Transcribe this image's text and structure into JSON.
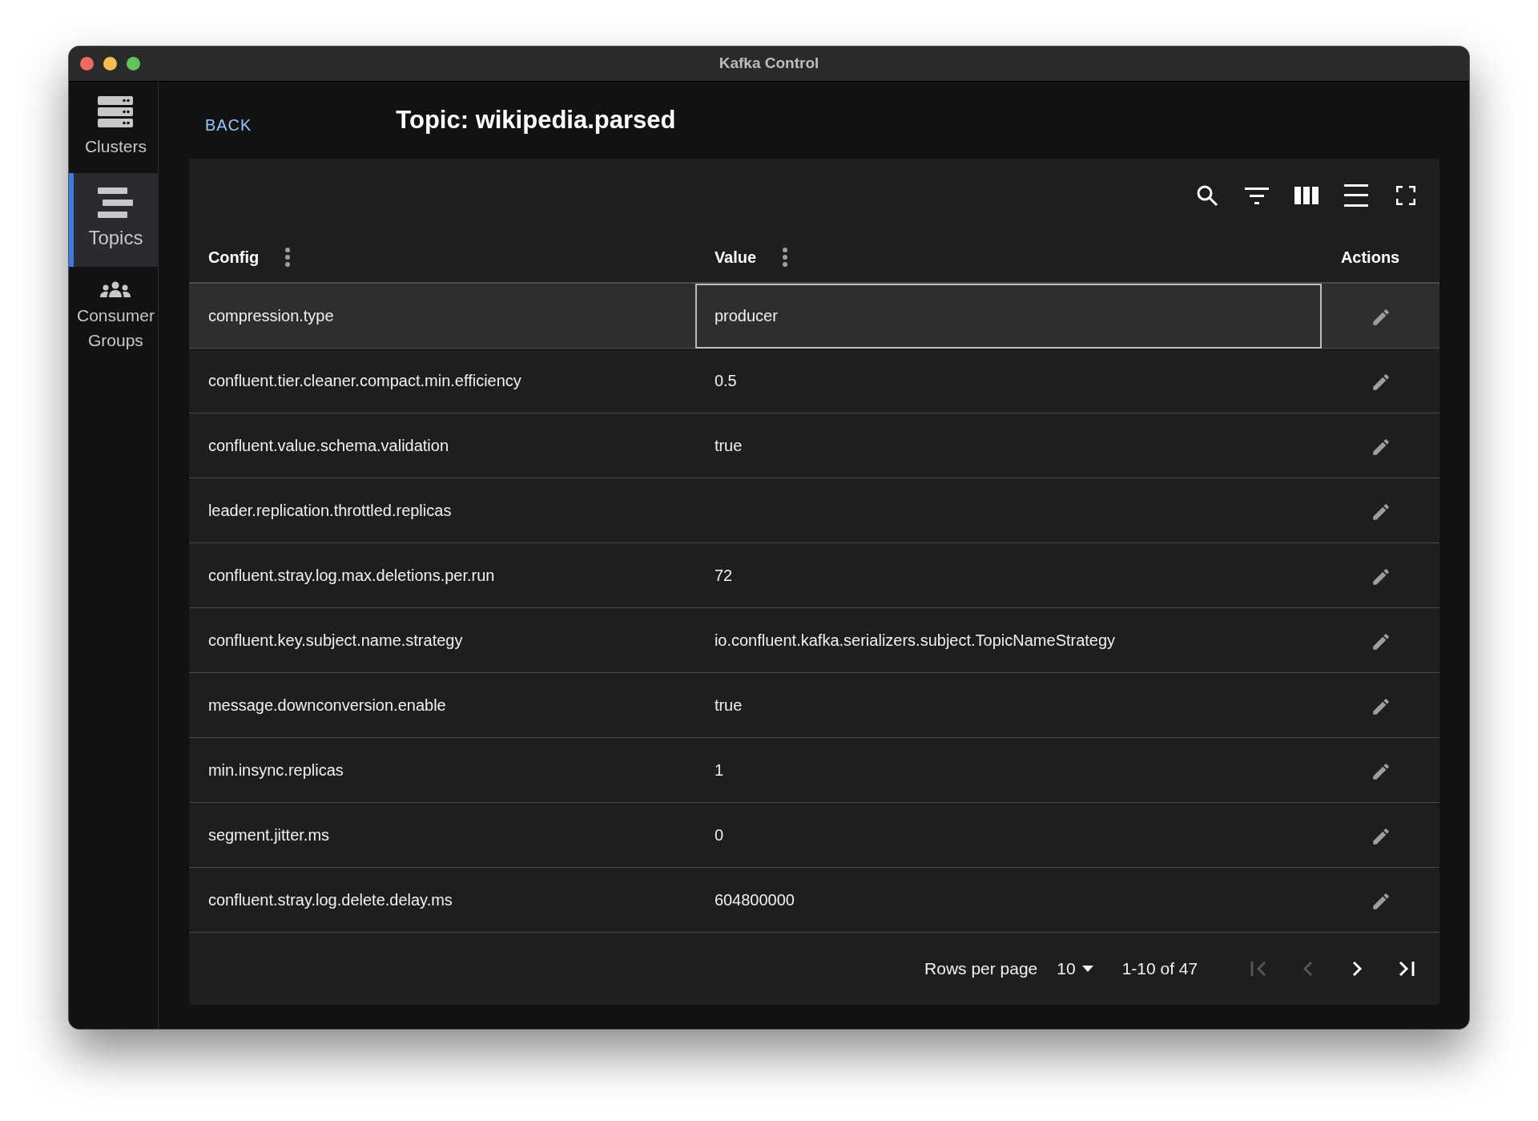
{
  "window": {
    "title": "Kafka Control"
  },
  "sidebar": {
    "items": [
      {
        "label": "Clusters",
        "kind": "servers",
        "selected": false
      },
      {
        "label": "Topics",
        "kind": "lines",
        "selected": true
      },
      {
        "label": "Consumer Groups",
        "kind": "people",
        "selected": false
      }
    ]
  },
  "back": "BACK",
  "title": "Topic: wikipedia.parsed",
  "table": {
    "columns": [
      {
        "label": "Config",
        "menu": true
      },
      {
        "label": "Value",
        "menu": true
      },
      {
        "label": "Actions",
        "menu": false
      }
    ],
    "rows": [
      {
        "config": "compression.type",
        "value": "producer",
        "selected": true,
        "editing": true
      },
      {
        "config": "confluent.tier.cleaner.compact.min.efficiency",
        "value": "0.5",
        "selected": false,
        "editing": false
      },
      {
        "config": "confluent.value.schema.validation",
        "value": "true",
        "selected": false,
        "editing": false
      },
      {
        "config": "leader.replication.throttled.replicas",
        "selected": false,
        "editing": false
      },
      {
        "config": "confluent.stray.log.max.deletions.per.run",
        "value": "72",
        "selected": false,
        "editing": false
      },
      {
        "config": "confluent.key.subject.name.strategy",
        "value": "io.confluent.kafka.serializers.subject.TopicNameStrategy",
        "selected": false,
        "editing": false
      },
      {
        "config": "message.downconversion.enable",
        "value": "true",
        "selected": false,
        "editing": false
      },
      {
        "config": "min.insync.replicas",
        "value": "1",
        "selected": false,
        "editing": false
      },
      {
        "config": "segment.jitter.ms",
        "value": "0",
        "selected": false,
        "editing": false
      },
      {
        "config": "confluent.stray.log.delete.delay.ms",
        "value": "604800000",
        "selected": false,
        "editing": false
      }
    ]
  },
  "pagination": {
    "rows_per_page_label": "Rows per page",
    "rows_per_page": "10",
    "range": "1-10 of 47",
    "buttons": [
      {
        "kind": "first",
        "disabled": true
      },
      {
        "kind": "prev",
        "disabled": true
      },
      {
        "kind": "next",
        "disabled": false
      },
      {
        "kind": "last",
        "disabled": false
      }
    ]
  }
}
